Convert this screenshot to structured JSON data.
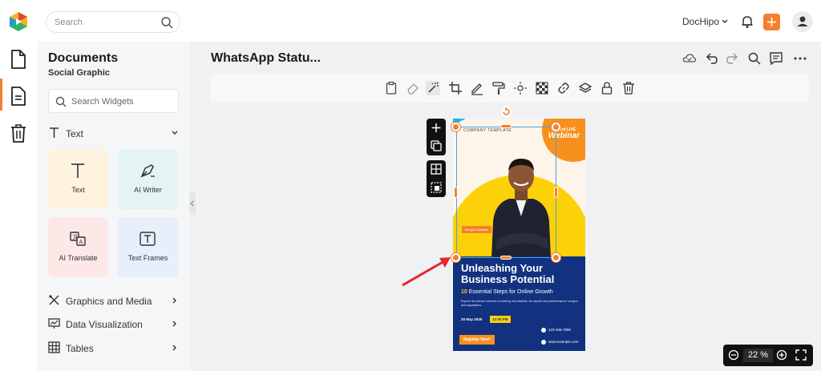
{
  "topbar": {
    "search_placeholder": "Search",
    "account_name": "DocHipo"
  },
  "panel": {
    "title": "Documents",
    "subtitle": "Social Graphic",
    "widget_search_placeholder": "Search Widgets",
    "text_section": "Text",
    "cards": [
      {
        "label": "Text"
      },
      {
        "label": "AI Writer"
      },
      {
        "label": "AI Translate"
      },
      {
        "label": "Text Frames"
      }
    ],
    "sections": [
      {
        "label": "Graphics and Media"
      },
      {
        "label": "Data Visualization"
      },
      {
        "label": "Tables"
      }
    ]
  },
  "editor": {
    "doc_title": "WhatsApp Statu..."
  },
  "design": {
    "company": "COMPANY TEMPLATE",
    "live": "3rd LIVE",
    "webinar": "Webinar",
    "name_tag": "Morgan Maxwell",
    "headline": "Unleashing Your Business Potential",
    "sub_num": "10",
    "sub_text": "Essential Steps for Online Growth",
    "body": "Explore the various methods of entering new Markets, for exports and partnerships to mergers and acquisitions.",
    "date": "20 May 2025",
    "time": "12:00 PM",
    "phone": "123-456-7890",
    "website": "www.example.com",
    "register": "Register Now!"
  },
  "zoom": {
    "value": "22",
    "unit": "%"
  },
  "colors": {
    "accent": "#f47f2c",
    "navy": "#12317f",
    "yellow": "#fdd108",
    "selection": "#4aa3df"
  }
}
